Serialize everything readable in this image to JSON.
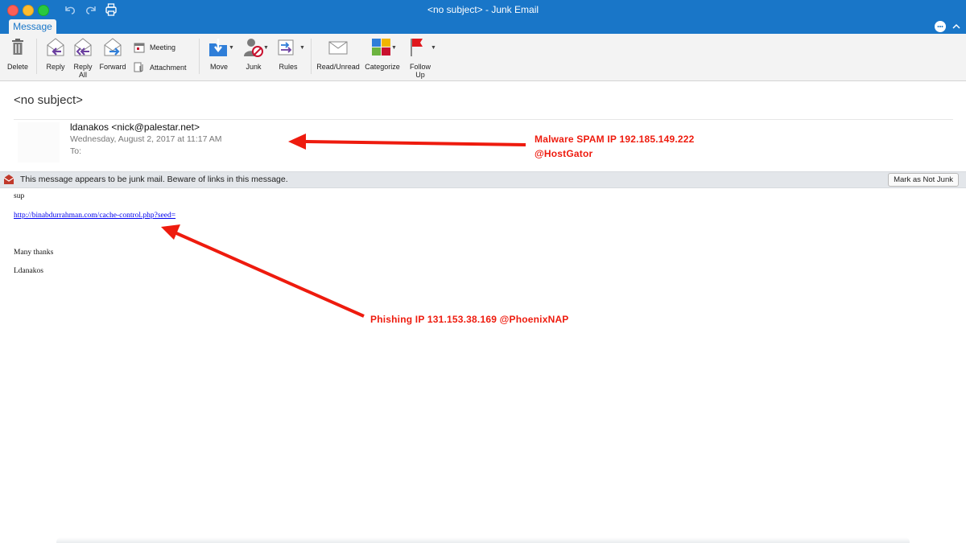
{
  "window": {
    "title": "<no subject> - Junk Email"
  },
  "tabs": {
    "message": "Message"
  },
  "ribbon": {
    "delete": "Delete",
    "reply": "Reply",
    "reply_all": "Reply\nAll",
    "forward": "Forward",
    "meeting": "Meeting",
    "attachment": "Attachment",
    "move": "Move",
    "junk": "Junk",
    "rules": "Rules",
    "read_unread": "Read/Unread",
    "categorize": "Categorize",
    "follow_up": "Follow\nUp"
  },
  "message": {
    "subject": "<no subject>",
    "from": "ldanakos <nick@palestar.net>",
    "date": "Wednesday, August 2, 2017 at 11:17 AM",
    "to_label": "To:"
  },
  "junk_bar": {
    "text": "This message appears to be junk mail. Beware of links in this message.",
    "button": "Mark as Not Junk"
  },
  "body": {
    "line1": "sup",
    "link": "http://binabdurrahman.com/cache-control.php?seed=",
    "thanks": "Many thanks",
    "signature": "Ldanakos"
  },
  "annotations": {
    "malware_line1": "Malware SPAM IP 192.185.149.222",
    "malware_line2": "@HostGator",
    "phishing": "Phishing IP 131.153.38.169 @PhoenixNAP"
  },
  "colors": {
    "accent": "#1976c8",
    "annotation": "#ee1b0e"
  }
}
